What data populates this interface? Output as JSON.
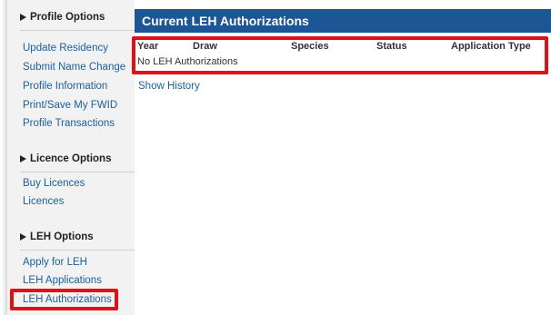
{
  "sidebar": {
    "profile_heading": "Profile Options",
    "profile_items": [
      "Update Residency",
      "Submit Name Change",
      "Profile Information",
      "Print/Save My FWID",
      "Profile Transactions"
    ],
    "licence_heading": "Licence Options",
    "licence_items": [
      "Buy Licences",
      "Licences"
    ],
    "leh_heading": "LEH Options",
    "leh_items": [
      "Apply for LEH",
      "LEH Applications",
      "LEH Authorizations"
    ],
    "selected_item": "LEH Authorizations"
  },
  "main": {
    "title": "Current LEH Authorizations",
    "columns": [
      "Year",
      "Draw",
      "Species",
      "Status",
      "Application Type"
    ],
    "empty_message": "No LEH Authorizations",
    "show_history_label": "Show History"
  },
  "colors": {
    "header_bg": "#1c5695",
    "link": "#1a5f9c",
    "sidebar_bg": "#f2f2f2",
    "highlight": "#e10f17"
  }
}
